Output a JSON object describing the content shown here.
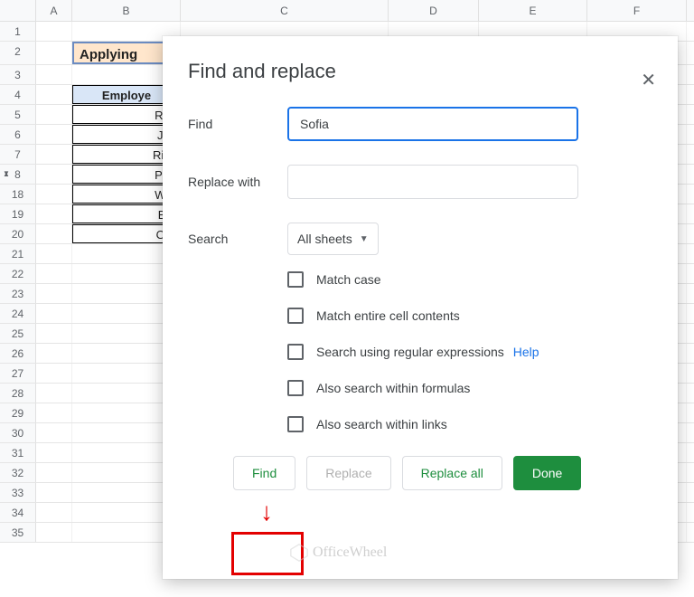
{
  "columns": [
    "A",
    "B",
    "C",
    "D",
    "E",
    "F"
  ],
  "row_numbers": [
    "1",
    "2",
    "3",
    "4",
    "5",
    "6",
    "7",
    "8",
    "18",
    "19",
    "20",
    "21",
    "22",
    "23",
    "24",
    "25",
    "26",
    "27",
    "28",
    "29",
    "30",
    "31",
    "32",
    "33",
    "34",
    "35"
  ],
  "title_cell": "Applying",
  "table_header": "Employe",
  "table_rows": [
    "Rob",
    "Joh",
    "Rich",
    "Patr",
    "Willi",
    "Bar",
    "Oliv"
  ],
  "dialog": {
    "title": "Find and replace",
    "find_label": "Find",
    "find_value": "Sofia",
    "replace_label": "Replace with",
    "replace_value": "",
    "search_label": "Search",
    "search_scope": "All sheets",
    "checkboxes": {
      "match_case": "Match case",
      "match_entire": "Match entire cell contents",
      "regex": "Search using regular expressions",
      "formulas": "Also search within formulas",
      "links": "Also search within links"
    },
    "help_link": "Help",
    "buttons": {
      "find": "Find",
      "replace": "Replace",
      "replace_all": "Replace all",
      "done": "Done"
    }
  },
  "watermark": "OfficeWheel"
}
